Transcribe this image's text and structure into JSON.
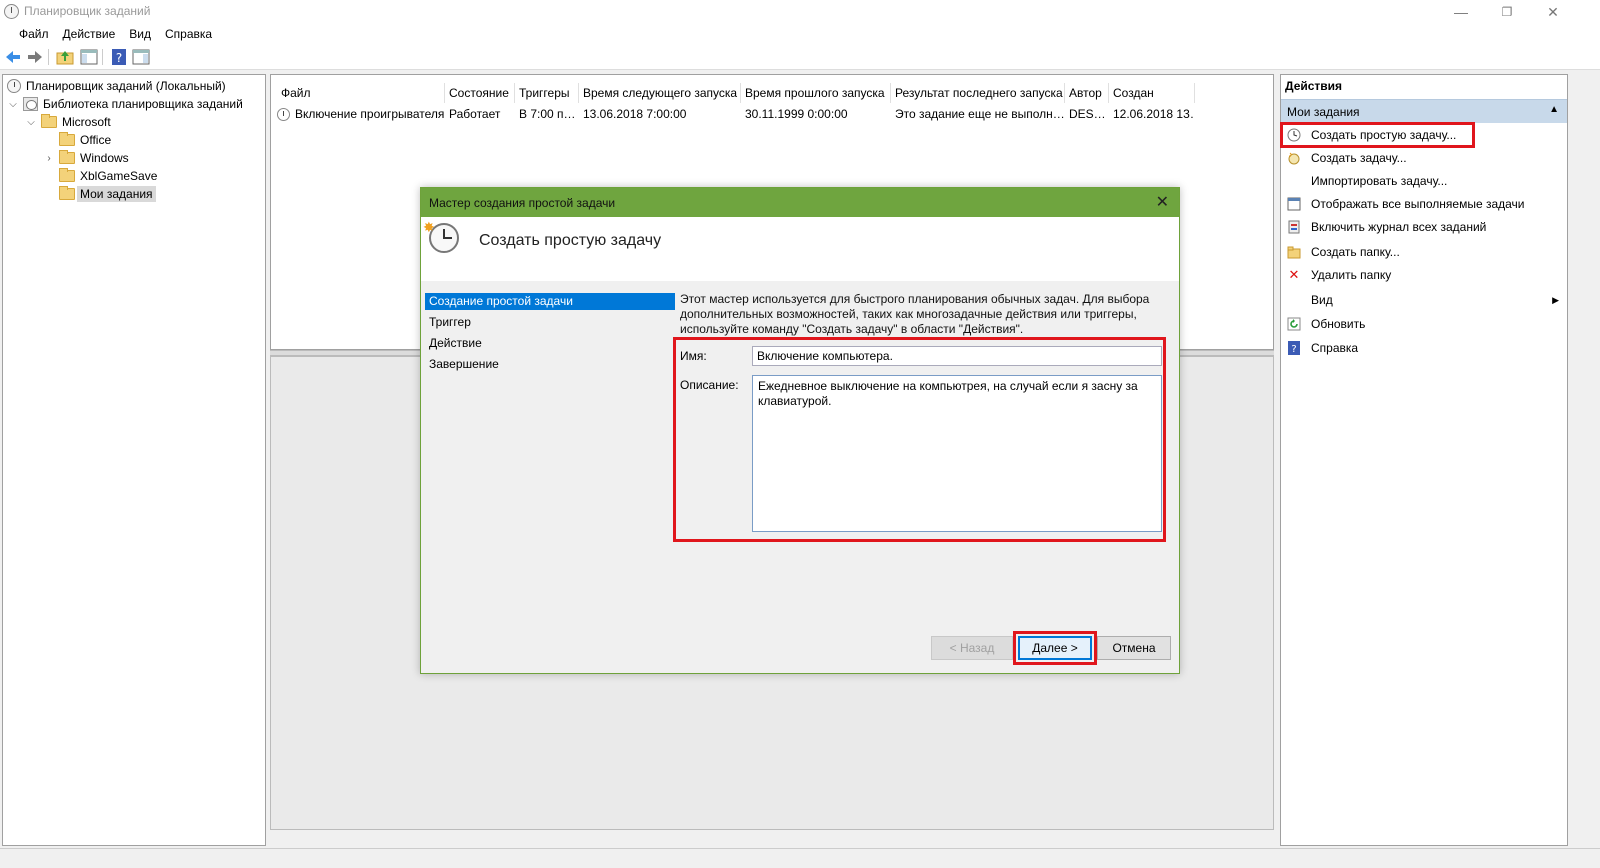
{
  "window": {
    "title": "Планировщик заданий",
    "minimize_glyph": "—",
    "restore_glyph": "❐",
    "close_glyph": "✕"
  },
  "menu": [
    "Файл",
    "Действие",
    "Вид",
    "Справка"
  ],
  "toolbar": {
    "icons": [
      "back-arrow-icon",
      "forward-arrow-icon",
      "up-folder-icon",
      "show-hide-tree-icon",
      "help-icon",
      "show-hide-action-pane-icon"
    ]
  },
  "tree": {
    "root": "Планировщик заданий (Локальный)",
    "library": "Библиотека планировщика заданий",
    "microsoft": "Microsoft",
    "office": "Office",
    "windows": "Windows",
    "xbl": "XblGameSave",
    "my_tasks": "Мои задания"
  },
  "task_list": {
    "columns": [
      "Файл",
      "Состояние",
      "Триггеры",
      "Время следующего запуска",
      "Время прошлого запуска",
      "Результат последнего запуска",
      "Автор",
      "Создан"
    ],
    "rows": [
      [
        "Включение проигрывателя",
        "Работает",
        "В 7:00 п…",
        "13.06.2018 7:00:00",
        "30.11.1999 0:00:00",
        "Это задание еще не выполн…",
        "DES…",
        "12.06.2018 13…"
      ]
    ]
  },
  "actions": {
    "title": "Действия",
    "section": "Мои задания",
    "items": [
      {
        "label": "Создать простую задачу...",
        "icon": "create-basic-task-icon"
      },
      {
        "label": "Создать задачу...",
        "icon": "create-task-icon"
      },
      {
        "label": "Импортировать задачу...",
        "icon": ""
      },
      {
        "label": "Отображать все выполняемые задачи",
        "icon": "running-tasks-icon"
      },
      {
        "label": "Включить журнал всех заданий",
        "icon": "history-log-icon"
      },
      {
        "label": "Создать папку...",
        "icon": "new-folder-icon"
      },
      {
        "label": "Удалить папку",
        "icon": "delete-icon"
      },
      {
        "label": "Вид",
        "icon": ""
      },
      {
        "label": "Обновить",
        "icon": "refresh-icon"
      },
      {
        "label": "Справка",
        "icon": "help-icon"
      }
    ]
  },
  "dialog": {
    "title": "Мастер создания простой задачи",
    "heading": "Создать простую задачу",
    "steps": [
      "Создание простой задачи",
      "Триггер",
      "Действие",
      "Завершение"
    ],
    "description": "Этот мастер используется для быстрого планирования обычных задач.  Для выбора дополнительных возможностей, таких как многозадачные действия или триггеры, используйте команду \"Создать задачу\" в области \"Действия\".",
    "name_label": "Имя:",
    "name_value": "Включение компьютера.",
    "desc_label": "Описание:",
    "desc_value": "Ежедневное выключение на компьютрея, на случай если я засну за клавиатурой.",
    "back_button": "< Назад",
    "next_button": "Далее >",
    "cancel_button": "Отмена"
  },
  "colors": {
    "dialog_title": "#6fa53f",
    "highlight": "#e0161c",
    "selection": "#0078d7"
  }
}
